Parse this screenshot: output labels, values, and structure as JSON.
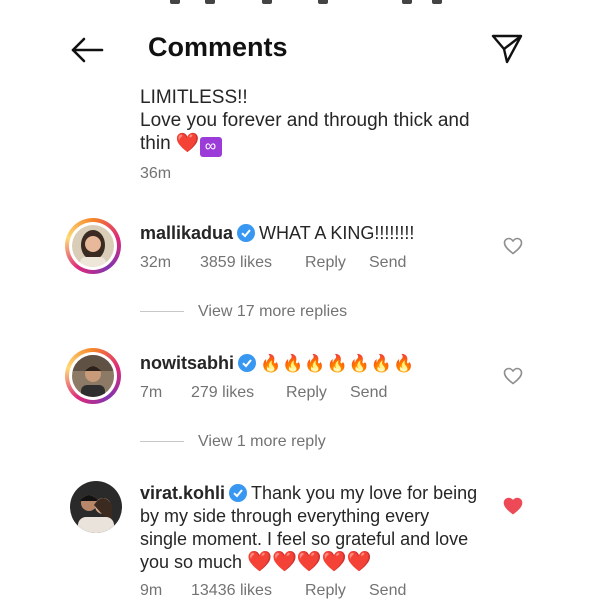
{
  "header": {
    "title": "Comments"
  },
  "top_comment": {
    "lines": [
      "LIMITLESS!!",
      "Love you forever and through thick and thin"
    ],
    "emojis": [
      "❤️",
      "♾️"
    ],
    "time": "36m"
  },
  "comments": [
    {
      "username": "mallikadua",
      "verified": true,
      "text": "WHAT A KING!!!!!!!!",
      "time": "32m",
      "likes": "3859 likes",
      "reply_label": "Reply",
      "send_label": "Send",
      "liked": false,
      "view_replies": "View 17 more replies"
    },
    {
      "username": "nowitsabhi",
      "verified": true,
      "text": "🔥🔥🔥🔥🔥🔥🔥",
      "time": "7m",
      "likes": "279 likes",
      "reply_label": "Reply",
      "send_label": "Send",
      "liked": false,
      "view_replies": "View 1 more reply"
    },
    {
      "username": "virat.kohli",
      "verified": true,
      "text": "Thank you my love for being by my side through everything every single moment. I feel so grateful and love you so much",
      "text_emojis": "❤️❤️❤️❤️❤️",
      "time": "9m",
      "likes": "13436 likes",
      "reply_label": "Reply",
      "send_label": "Send",
      "liked": true
    }
  ],
  "colors": {
    "like_red": "#ed4956",
    "verified_blue": "#3897f0",
    "meta_gray": "#737373"
  },
  "icons": [
    "back-arrow-icon",
    "direct-message-icon",
    "verified-badge-icon",
    "heart-outline-icon",
    "heart-filled-icon"
  ]
}
